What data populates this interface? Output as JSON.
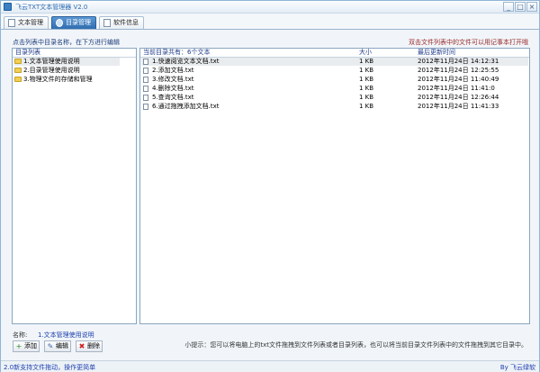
{
  "window": {
    "title": "飞云TXT文本管理器 V2.0",
    "controls": [
      "_",
      "□",
      "×"
    ]
  },
  "tabs": [
    {
      "label": "文本管理",
      "active": false,
      "icon": "document-icon"
    },
    {
      "label": "目录管理",
      "active": true,
      "icon": "gear-icon"
    },
    {
      "label": "软件信息",
      "active": false,
      "icon": "info-icon"
    }
  ],
  "hints": {
    "left": "点击列表中目录名称，在下方进行编辑",
    "right": "双击文件列表中的文件可以用记事本打开哦"
  },
  "directory_panel": {
    "header": "目录列表",
    "items": [
      {
        "label": "1.文本管理使用说明",
        "selected": true
      },
      {
        "label": "2.目录管理使用说明",
        "selected": false
      },
      {
        "label": "3.物理文件的存储和管理",
        "selected": false
      }
    ]
  },
  "file_panel": {
    "headers": {
      "name": "当前目录共有：6个文本",
      "size": "大小",
      "time": "最后更新时间"
    },
    "rows": [
      {
        "name": "1.快速阅览文本文档.txt",
        "size": "1 KB",
        "time": "2012年11月24日 14:12:31",
        "selected": true
      },
      {
        "name": "2.添加文档.txt",
        "size": "1 KB",
        "time": "2012年11月24日 12:25:55",
        "selected": false
      },
      {
        "name": "3.修改文档.txt",
        "size": "1 KB",
        "time": "2012年11月24日 11:40:49",
        "selected": false
      },
      {
        "name": "4.删除文档.txt",
        "size": "1 KB",
        "time": "2012年11月24日 11:41:0",
        "selected": false
      },
      {
        "name": "5.查询文档.txt",
        "size": "1 KB",
        "time": "2012年11月24日 12:26:44",
        "selected": false
      },
      {
        "name": "6.通过拖拽添加文档.txt",
        "size": "1 KB",
        "time": "2012年11月24日 11:41:33",
        "selected": false
      }
    ]
  },
  "editor": {
    "name_label": "名称:",
    "name_value": "1.文本管理使用说明",
    "add_label": "添加",
    "edit_label": "编辑",
    "delete_label": "删除"
  },
  "tip": "小提示：您可以将电脑上的txt文件拖拽到文件列表或者目录列表，也可以将当前目录文件列表中的文件拖拽到其它目录中。",
  "status": {
    "left": "2.0新支持文件拖动，操作更简单",
    "right": "By 飞云绿软"
  }
}
